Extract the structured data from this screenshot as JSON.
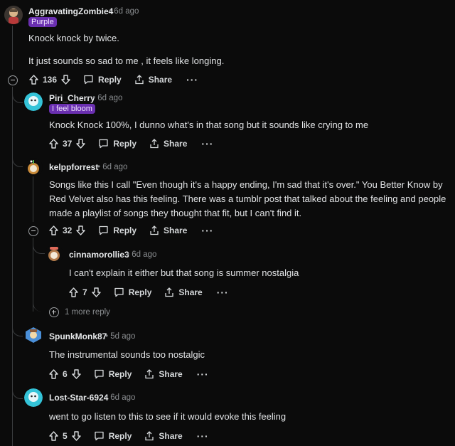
{
  "comments": [
    {
      "user": "AggravatingZombie4",
      "time": "6d ago",
      "flair": "Purple",
      "body": [
        "Knock knock by twice.",
        "It just sounds so sad to me , it feels like longing."
      ],
      "votes": "136",
      "reply": "Reply",
      "share": "Share",
      "more": "···"
    },
    {
      "user": "Piri_Cherry",
      "time": "6d ago",
      "flair": "I feel bloom",
      "body": [
        "Knock Knock 100%, I dunno what's in that song but it sounds like crying to me"
      ],
      "votes": "37",
      "reply": "Reply",
      "share": "Share",
      "more": "···"
    },
    {
      "user": "kelppforrest",
      "time": "6d ago",
      "body": [
        "Songs like this I call \"Even though it's a happy ending, I'm sad that it's over.\" You Better Know by Red Velvet also has this feeling. There was a tumblr post that talked about the feeling and people made a playlist of songs they thought that fit, but I can't find it."
      ],
      "votes": "32",
      "reply": "Reply",
      "share": "Share",
      "more": "···"
    },
    {
      "user": "cinnamorollie3",
      "time": "6d ago",
      "body": [
        "I can't explain it either but that song is summer nostalgia"
      ],
      "votes": "7",
      "reply": "Reply",
      "share": "Share",
      "more": "···"
    },
    {
      "user": "SpunkMonk87",
      "time": "5d ago",
      "body": [
        "The instrumental sounds too nostalgic"
      ],
      "votes": "6",
      "reply": "Reply",
      "share": "Share",
      "more": "···"
    },
    {
      "user": "Lost-Star-6924",
      "time": "6d ago",
      "body": [
        "went to go listen to this to see if it would evoke this feeling"
      ],
      "votes": "5",
      "reply": "Reply",
      "share": "Share",
      "more": "···"
    }
  ],
  "more_replies": "1 more reply",
  "sep": "•",
  "colors": {
    "bg": "#0b0b0b",
    "flair": "#6a2fb0",
    "thread": "#3a3c3e"
  }
}
